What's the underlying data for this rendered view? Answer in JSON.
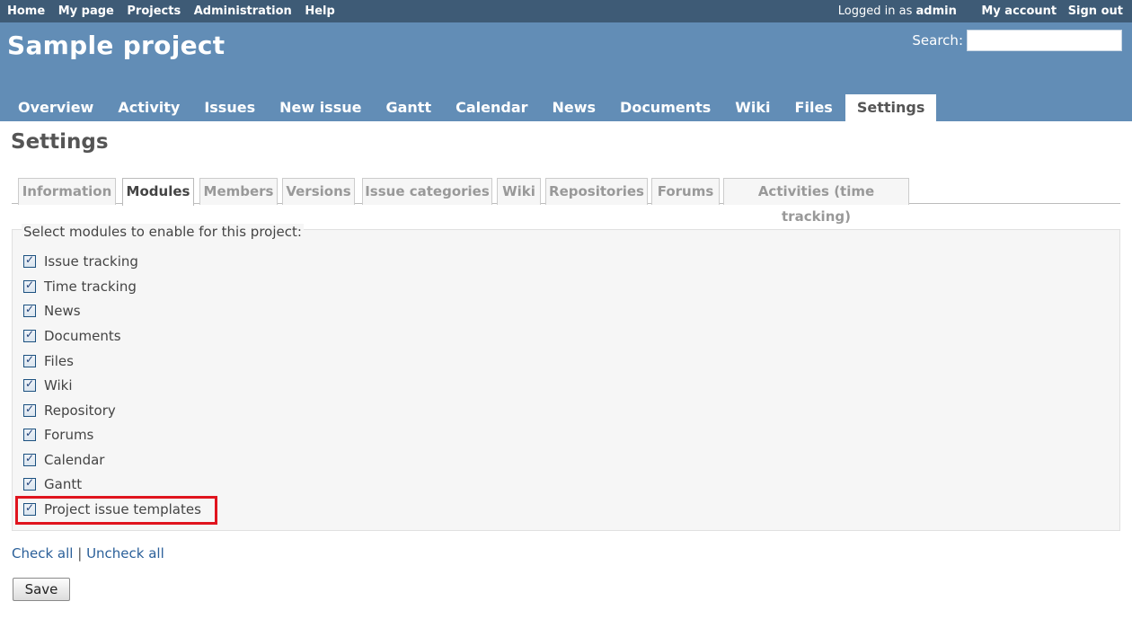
{
  "top_menu": {
    "left": [
      "Home",
      "My page",
      "Projects",
      "Administration",
      "Help"
    ],
    "logged_prefix": "Logged in as",
    "user": "admin",
    "my_account": "My account",
    "sign_out": "Sign out"
  },
  "header": {
    "title": "Sample project",
    "search_label": "Search:",
    "search_value": ""
  },
  "main_menu": [
    "Overview",
    "Activity",
    "Issues",
    "New issue",
    "Gantt",
    "Calendar",
    "News",
    "Documents",
    "Wiki",
    "Files",
    "Settings"
  ],
  "main_menu_selected": "Settings",
  "page_title": "Settings",
  "tabs": [
    "Information",
    "Modules",
    "Members",
    "Versions",
    "Issue categories",
    "Wiki",
    "Repositories",
    "Forums",
    "Activities (time tracking)"
  ],
  "tab_selected": "Modules",
  "modules_box": {
    "legend": "Select modules to enable for this project:",
    "modules": [
      {
        "label": "Issue tracking",
        "checked": true
      },
      {
        "label": "Time tracking",
        "checked": true
      },
      {
        "label": "News",
        "checked": true
      },
      {
        "label": "Documents",
        "checked": true
      },
      {
        "label": "Files",
        "checked": true
      },
      {
        "label": "Wiki",
        "checked": true
      },
      {
        "label": "Repository",
        "checked": true
      },
      {
        "label": "Forums",
        "checked": true
      },
      {
        "label": "Calendar",
        "checked": true
      },
      {
        "label": "Gantt",
        "checked": true
      },
      {
        "label": "Project issue templates",
        "checked": true
      }
    ]
  },
  "check_all": "Check all",
  "separator": "|",
  "uncheck_all": "Uncheck all",
  "save": "Save",
  "colors": {
    "top_bar": "#3e5b76",
    "header": "#628db6",
    "highlight": "#e0141e",
    "link": "#2a5f99"
  }
}
